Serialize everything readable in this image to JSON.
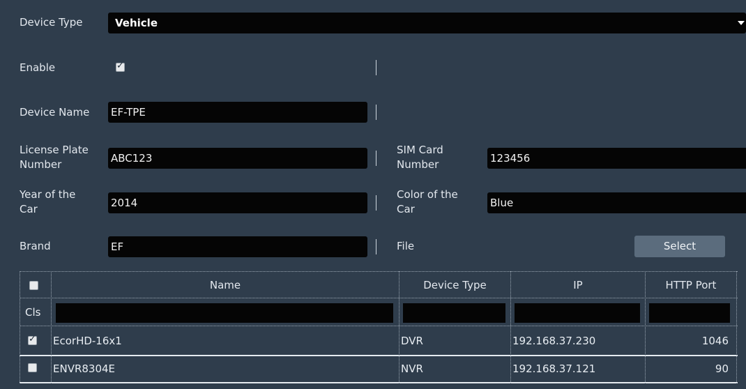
{
  "form": {
    "device_type": {
      "label": "Device Type",
      "value": "Vehicle"
    },
    "enable": {
      "label": "Enable",
      "checked": true
    },
    "device_name": {
      "label": "Device Name",
      "value": "EF-TPE"
    },
    "license_plate": {
      "label": "License Plate Number",
      "value": "ABC123"
    },
    "sim_card": {
      "label": "SIM Card Number",
      "value": "123456"
    },
    "year": {
      "label": "Year of the Car",
      "value": "2014"
    },
    "color": {
      "label": "Color of the Car",
      "value": "Blue"
    },
    "brand": {
      "label": "Brand",
      "value": "EF"
    },
    "file": {
      "label": "File",
      "button": "Select"
    }
  },
  "table": {
    "headers": {
      "name": "Name",
      "device_type": "Device Type",
      "ip": "IP",
      "http_port": "HTTP Port"
    },
    "filter_label": "Cls",
    "rows": [
      {
        "checked": true,
        "name": "EcorHD-16x1",
        "device_type": "DVR",
        "ip": "192.168.37.230",
        "http_port": "1046"
      },
      {
        "checked": false,
        "name": "ENVR8304E",
        "device_type": "NVR",
        "ip": "192.168.37.121",
        "http_port": "90"
      }
    ]
  }
}
